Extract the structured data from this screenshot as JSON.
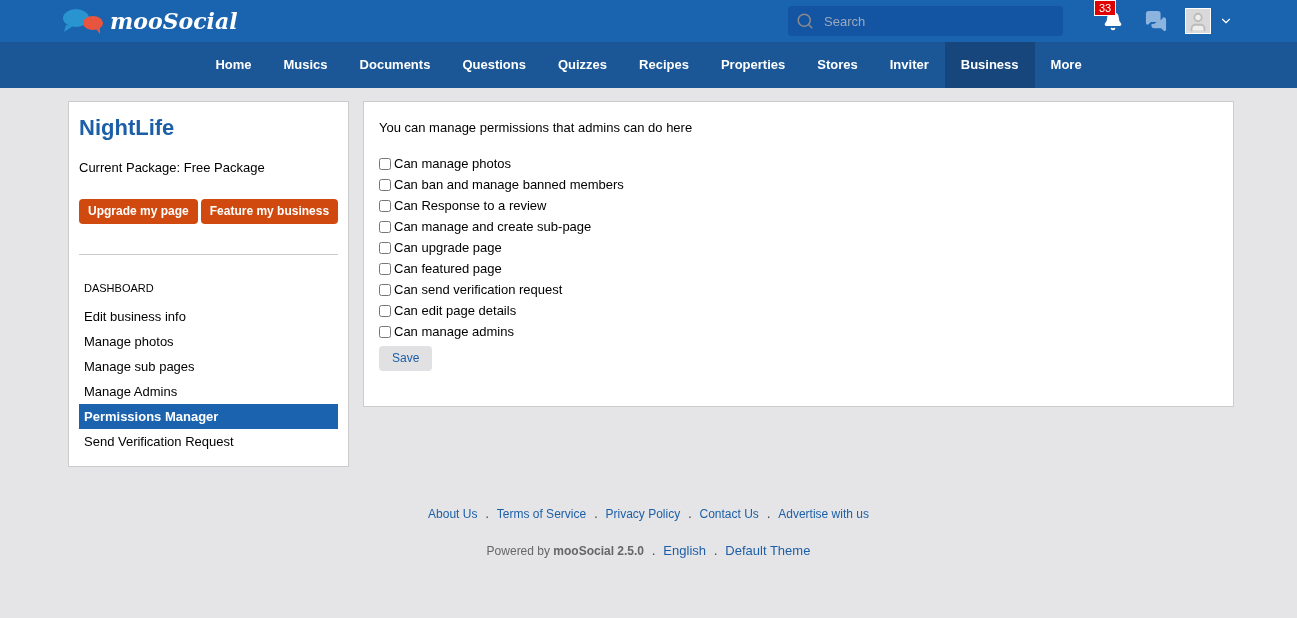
{
  "header": {
    "logo": "mooSocial",
    "search": {
      "placeholder": "Search"
    },
    "notification_count": "33"
  },
  "nav": [
    {
      "label": "Home",
      "selected": false
    },
    {
      "label": "Musics",
      "selected": false
    },
    {
      "label": "Documents",
      "selected": false
    },
    {
      "label": "Questions",
      "selected": false
    },
    {
      "label": "Quizzes",
      "selected": false
    },
    {
      "label": "Recipes",
      "selected": false
    },
    {
      "label": "Properties",
      "selected": false
    },
    {
      "label": "Stores",
      "selected": false
    },
    {
      "label": "Inviter",
      "selected": false
    },
    {
      "label": "Business",
      "selected": true
    },
    {
      "label": "More",
      "selected": false
    }
  ],
  "sidebar": {
    "title": "NightLife",
    "package": "Current Package: Free Package",
    "buttons": [
      "Upgrade my page",
      "Feature my business"
    ],
    "section": "DASHBOARD",
    "items": [
      {
        "label": "Edit business info",
        "selected": false
      },
      {
        "label": "Manage photos",
        "selected": false
      },
      {
        "label": "Manage sub pages",
        "selected": false
      },
      {
        "label": "Manage Admins",
        "selected": false
      },
      {
        "label": "Permissions Manager",
        "selected": true
      },
      {
        "label": "Send Verification Request",
        "selected": false
      }
    ]
  },
  "main": {
    "intro": "You can manage permissions that admins can do here",
    "permissions": [
      {
        "label": "Can manage photos",
        "checked": false
      },
      {
        "label": "Can ban and manage banned members",
        "checked": false
      },
      {
        "label": "Can Response to a review",
        "checked": false
      },
      {
        "label": "Can manage and create sub-page",
        "checked": false
      },
      {
        "label": "Can upgrade page",
        "checked": false
      },
      {
        "label": "Can featured page",
        "checked": false
      },
      {
        "label": "Can send verification request",
        "checked": false
      },
      {
        "label": "Can edit page details",
        "checked": false
      },
      {
        "label": "Can manage admins",
        "checked": false
      }
    ],
    "save": "Save"
  },
  "footer": {
    "links": [
      "About Us",
      "Terms of Service",
      "Privacy Policy",
      "Contact Us",
      "Advertise with us"
    ],
    "separator": ".",
    "powered": "Powered by **mooSocial 2.5.0**",
    "extras": [
      "English",
      "Default Theme"
    ]
  }
}
